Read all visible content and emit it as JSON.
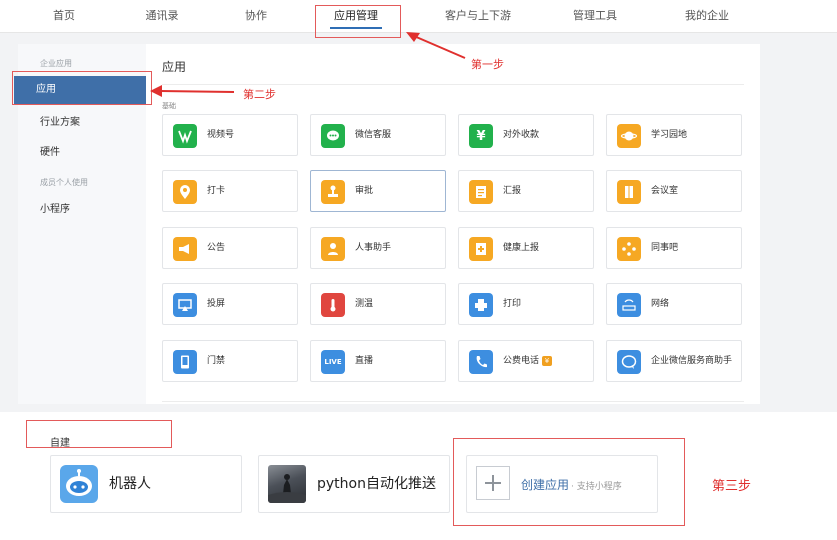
{
  "nav": {
    "items": [
      {
        "label": "首页"
      },
      {
        "label": "通讯录"
      },
      {
        "label": "协作"
      },
      {
        "label": "应用管理"
      },
      {
        "label": "客户与上下游"
      },
      {
        "label": "管理工具"
      },
      {
        "label": "我的企业"
      }
    ],
    "active_index": 3
  },
  "sidebar": {
    "group_enterprise": "企业应用",
    "items_enterprise": [
      "应用",
      "行业方案",
      "硬件"
    ],
    "group_personal": "成员个人使用",
    "items_personal": [
      "小程序"
    ]
  },
  "main": {
    "title": "应用",
    "section_label": "基础",
    "apps": [
      {
        "label": "视频号",
        "icon": "video-channel-icon",
        "color": "#22b14c"
      },
      {
        "label": "微信客服",
        "icon": "chat-bubble-icon",
        "color": "#22b14c"
      },
      {
        "label": "对外收款",
        "icon": "yuan-icon",
        "color": "#22b14c"
      },
      {
        "label": "学习园地",
        "icon": "planet-icon",
        "color": "#f6a823"
      },
      {
        "label": "打卡",
        "icon": "location-pin-icon",
        "color": "#f6a823"
      },
      {
        "label": "审批",
        "icon": "stamp-icon",
        "color": "#f6a823"
      },
      {
        "label": "汇报",
        "icon": "report-doc-icon",
        "color": "#f6a823"
      },
      {
        "label": "会议室",
        "icon": "door-icon",
        "color": "#f6a823"
      },
      {
        "label": "公告",
        "icon": "megaphone-icon",
        "color": "#f6a823"
      },
      {
        "label": "人事助手",
        "icon": "person-icon",
        "color": "#f6a823"
      },
      {
        "label": "健康上报",
        "icon": "health-clipboard-icon",
        "color": "#f6a823"
      },
      {
        "label": "同事吧",
        "icon": "diamond-dots-icon",
        "color": "#f6a823"
      },
      {
        "label": "投屏",
        "icon": "screen-cast-icon",
        "color": "#3d8ee0"
      },
      {
        "label": "测温",
        "icon": "thermometer-icon",
        "color": "#e0463f"
      },
      {
        "label": "打印",
        "icon": "printer-icon",
        "color": "#3d8ee0"
      },
      {
        "label": "网络",
        "icon": "wifi-router-icon",
        "color": "#3d8ee0"
      },
      {
        "label": "门禁",
        "icon": "access-door-icon",
        "color": "#3d8ee0"
      },
      {
        "label": "直播",
        "icon": "live-icon",
        "color": "#3d8ee0"
      },
      {
        "label": "公费电话",
        "icon": "phone-icon",
        "color": "#3d8ee0"
      },
      {
        "label": "企业微信服务商助手",
        "icon": "service-chat-icon",
        "color": "#3d8ee0"
      }
    ],
    "badge_text": "¥",
    "live_text": "LIVE"
  },
  "create": {
    "section_label": "自建",
    "items": [
      {
        "label": "机器人",
        "icon": "robot-icon"
      },
      {
        "label": "python自动化推送",
        "icon": "thumbnail-image-icon"
      }
    ],
    "create_app": {
      "label": "创建应用",
      "sublabel": "· 支持小程序",
      "icon": "plus-icon"
    }
  },
  "annotations": {
    "step1": "第一步",
    "step2": "第二步",
    "step3": "第三步",
    "color": "#e0302e"
  }
}
